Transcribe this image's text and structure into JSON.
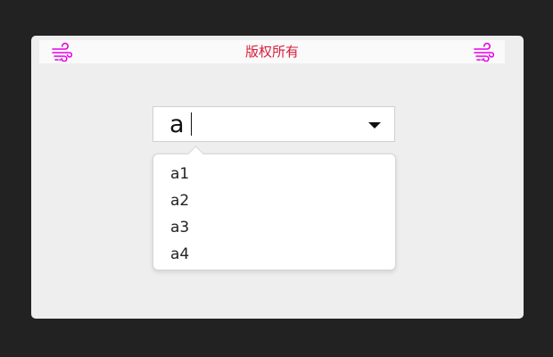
{
  "header": {
    "title": "版权所有",
    "left_icon": "wind-icon",
    "right_icon": "wind-icon",
    "accent_color": "#e800e8",
    "title_color": "#d81e3a"
  },
  "combo": {
    "value": "a",
    "arrow_icon": "caret-down-icon"
  },
  "dropdown": {
    "options": [
      "a1",
      "a2",
      "a3",
      "a4"
    ]
  }
}
